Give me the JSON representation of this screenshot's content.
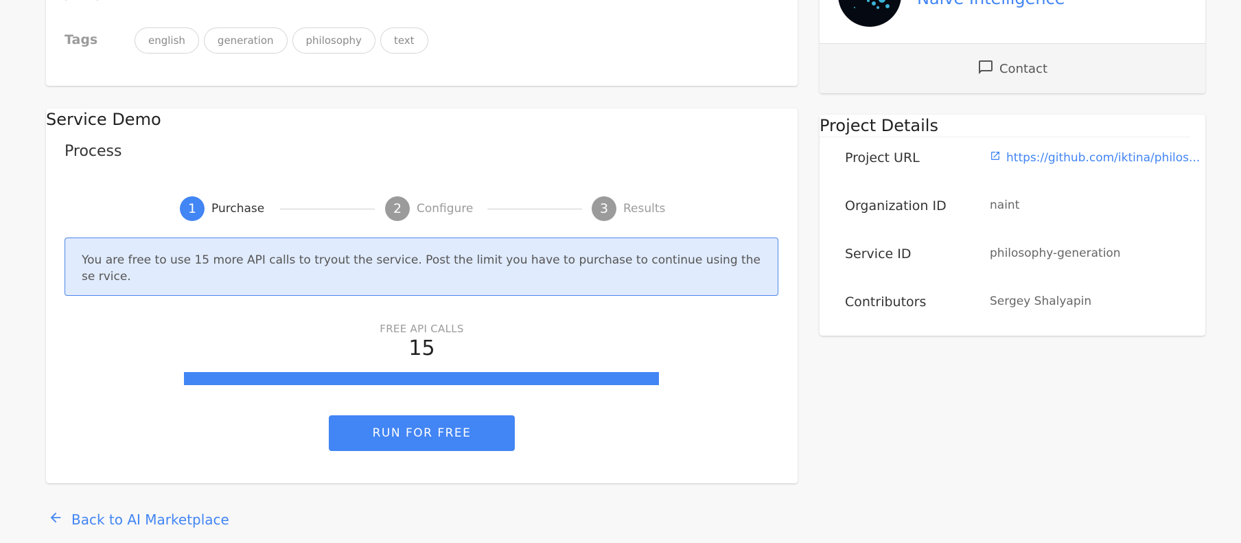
{
  "tags": {
    "label": "Tags",
    "items": [
      "english",
      "generation",
      "philosophy",
      "text"
    ]
  },
  "service_demo": {
    "title": "Service Demo",
    "process_title": "Process",
    "steps": [
      {
        "number": "1",
        "label": "Purchase"
      },
      {
        "number": "2",
        "label": "Configure"
      },
      {
        "number": "3",
        "label": "Results"
      }
    ],
    "alert_text": "You are free to use 15 more API calls to tryout the service. Post the limit you have to purchase to continue using the se rvice.",
    "free_calls_label": "FREE API CALLS",
    "free_calls_count": "15",
    "free_calls_progress_percent": 100,
    "run_button_label": "RUN FOR FREE"
  },
  "back_link": {
    "label": "Back to AI Marketplace"
  },
  "organization": {
    "name": "Naive Intelligence",
    "contact_label": "Contact"
  },
  "project_details": {
    "title": "Project Details",
    "rows": [
      {
        "key": "Project URL",
        "value": "https://github.com/iktina/philos..."
      },
      {
        "key": "Organization ID",
        "value": "naint"
      },
      {
        "key": "Service ID",
        "value": "philosophy-generation"
      },
      {
        "key": "Contributors",
        "value": "Sergey Shalyapin"
      }
    ]
  },
  "colors": {
    "accent": "#4285f4",
    "step_active": "#4285f4",
    "step_inactive": "#9b9b9b",
    "alert_bg": "#e0ebfd",
    "alert_border": "#4e86e8"
  }
}
